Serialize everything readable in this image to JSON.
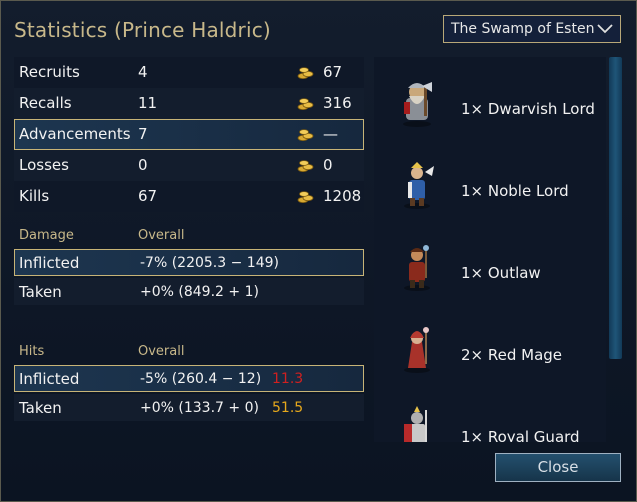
{
  "title": "Statistics (Prince Haldric)",
  "scenario_select": {
    "selected": "The Swamp of Esten"
  },
  "stats": [
    {
      "label": "Recruits",
      "value": "4",
      "cost": "67"
    },
    {
      "label": "Recalls",
      "value": "11",
      "cost": "316"
    },
    {
      "label": "Advancements",
      "value": "7",
      "cost": "—"
    },
    {
      "label": "Losses",
      "value": "0",
      "cost": "0"
    },
    {
      "label": "Kills",
      "value": "67",
      "cost": "1208"
    }
  ],
  "damage": {
    "header": "Damage",
    "overall_header": "Overall",
    "inflicted_label": "Inflicted",
    "inflicted_value": "-7% (2205.3 − 149)",
    "taken_label": "Taken",
    "taken_value": "+0% (849.2 + 1)"
  },
  "hits": {
    "header": "Hits",
    "overall_header": "Overall",
    "inflicted_label": "Inflicted",
    "inflicted_value": "-5% (260.4 − 12)",
    "inflicted_extra": "11.3",
    "taken_label": "Taken",
    "taken_value": "+0% (133.7 + 0)",
    "taken_extra": "51.5"
  },
  "units": [
    {
      "name": "1× Dwarvish Lord",
      "icon": "dwarvish-lord-sprite"
    },
    {
      "name": "1× Noble Lord",
      "icon": "noble-lord-sprite"
    },
    {
      "name": "1× Outlaw",
      "icon": "outlaw-sprite"
    },
    {
      "name": "2× Red Mage",
      "icon": "red-mage-sprite"
    },
    {
      "name": "1× Royal Guard",
      "icon": "royal-guard-sprite"
    }
  ],
  "close_label": "Close",
  "colors": {
    "gold_title": "#c8b88a",
    "red_value": "#d02020",
    "amber_value": "#e6a81c",
    "selection_border": "#c7b477"
  }
}
